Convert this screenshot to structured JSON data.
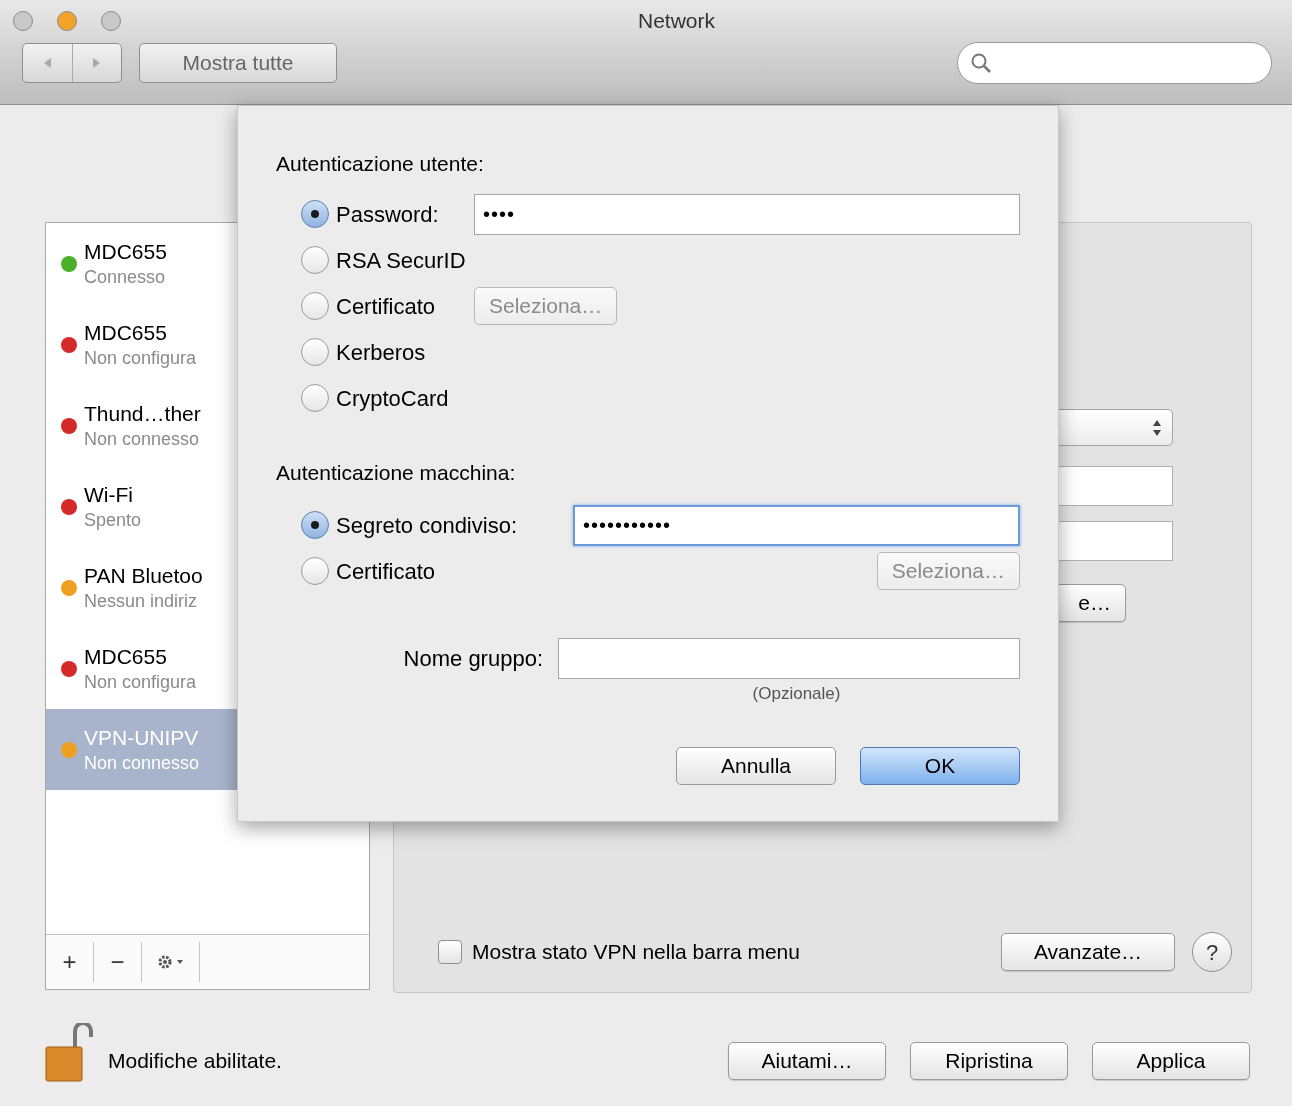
{
  "window": {
    "title": "Network"
  },
  "toolbar": {
    "show_all": "Mostra tutte"
  },
  "services": [
    {
      "name": "MDC655",
      "status": "Connesso",
      "color": "#4caf2a",
      "selected": false
    },
    {
      "name": "MDC655",
      "status": "Non configura",
      "color": "#d42a2a",
      "selected": false
    },
    {
      "name": "Thund…ther",
      "status": "Non connesso",
      "color": "#d42a2a",
      "selected": false
    },
    {
      "name": "Wi-Fi",
      "status": "Spento",
      "color": "#d42a2a",
      "selected": false
    },
    {
      "name": "PAN Bluetoo",
      "status": "Nessun indiriz",
      "color": "#f0a020",
      "selected": false
    },
    {
      "name": "MDC655",
      "status": "Non configura",
      "color": "#d42a2a",
      "selected": false
    },
    {
      "name": "VPN-UNIPV",
      "status": "Non connesso",
      "color": "#f0a020",
      "selected": true
    }
  ],
  "sidebar_tools": [
    "+",
    "−"
  ],
  "detail": {
    "auth_button_tail": "e…",
    "show_vpn_status": {
      "label": "Mostra stato VPN nella barra menu",
      "checked": false
    },
    "advanced": "Avanzate…",
    "help": "?"
  },
  "lock": {
    "text": "Modifiche abilitate."
  },
  "footer_buttons": [
    "Aiutami…",
    "Ripristina",
    "Applica"
  ],
  "sheet": {
    "user_auth": {
      "title": "Autenticazione utente:",
      "options": [
        {
          "kind": "password",
          "selected": true,
          "label": "Password:",
          "field": {
            "text": "••••",
            "focused": false
          }
        },
        {
          "kind": "plain",
          "label": "RSA SecurID",
          "selected": false
        },
        {
          "kind": "button",
          "label": "Certificato",
          "selected": false,
          "button": "Seleziona…",
          "disabled": true
        },
        {
          "kind": "plain",
          "label": "Kerberos",
          "selected": false
        },
        {
          "kind": "plain",
          "label": "CryptoCard",
          "selected": false
        }
      ]
    },
    "machine_auth": {
      "title": "Autenticazione macchina:",
      "options": [
        {
          "kind": "password",
          "selected": true,
          "label": "Segreto condiviso:",
          "field": {
            "text": "•••••••••••",
            "focused": true
          }
        },
        {
          "kind": "button",
          "label": "Certificato",
          "selected": false,
          "button": "Seleziona…",
          "disabled": true
        }
      ]
    },
    "group": {
      "label": "Nome gruppo:",
      "hint": "(Opzionale)"
    },
    "buttons": [
      {
        "label": "Annulla",
        "default": false
      },
      {
        "label": "OK",
        "default": true
      }
    ]
  }
}
